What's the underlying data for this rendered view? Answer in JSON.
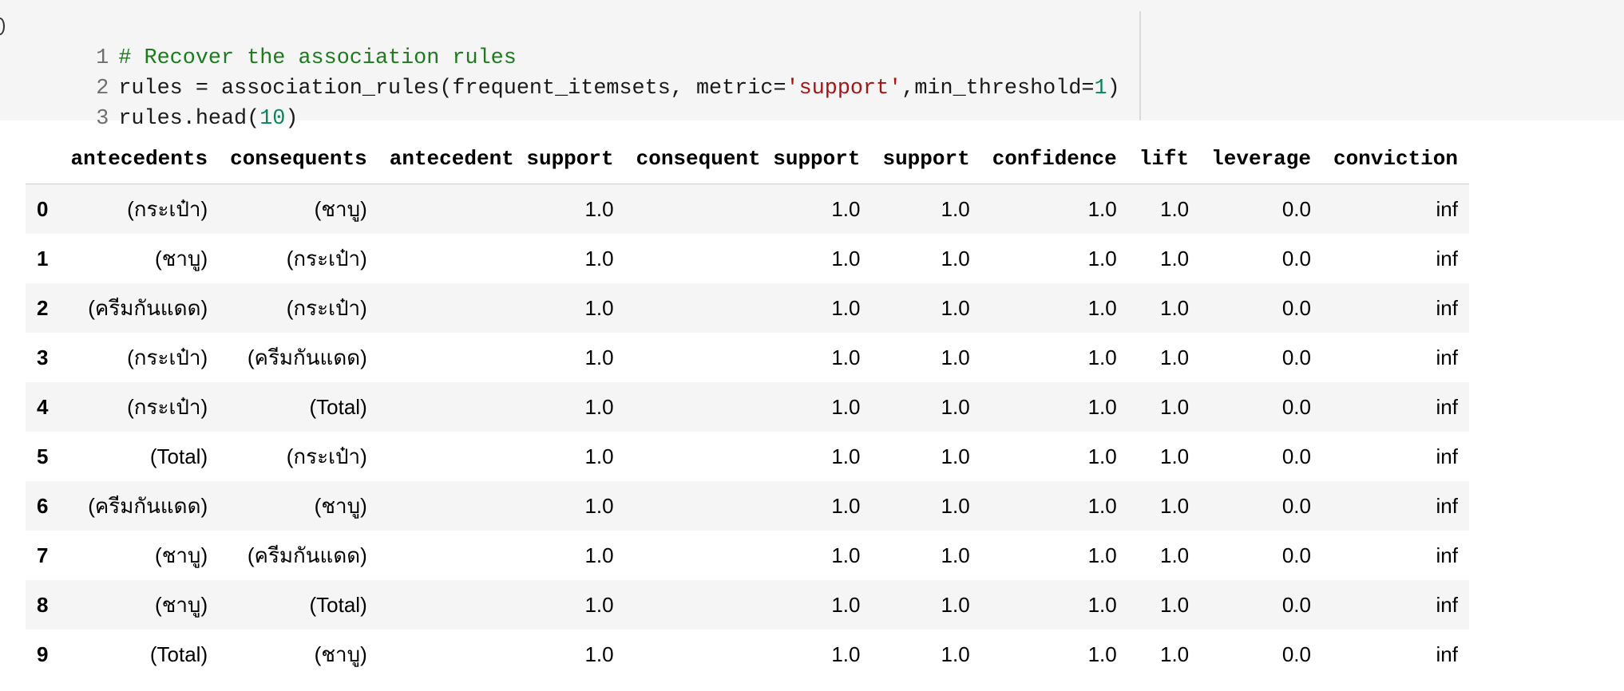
{
  "code": {
    "lines": [
      {
        "num": "1",
        "tokens": [
          {
            "t": "# Recover the association rules",
            "k": "comment"
          }
        ]
      },
      {
        "num": "2",
        "tokens": [
          {
            "t": "rules = association_rules(frequent_itemsets, metric=",
            "k": "plain"
          },
          {
            "t": "'support'",
            "k": "string"
          },
          {
            "t": ",min_threshold=",
            "k": "plain"
          },
          {
            "t": "1",
            "k": "number"
          },
          {
            "t": ")",
            "k": "plain"
          }
        ]
      },
      {
        "num": "3",
        "tokens": [
          {
            "t": "rules.head(",
            "k": "plain"
          },
          {
            "t": "10",
            "k": "number"
          },
          {
            "t": ")",
            "k": "plain"
          }
        ]
      }
    ]
  },
  "table": {
    "columns": [
      "antecedents",
      "consequents",
      "antecedent support",
      "consequent support",
      "support",
      "confidence",
      "lift",
      "leverage",
      "conviction"
    ],
    "rows": [
      {
        "index": "0",
        "cells": [
          "(กระเป๋า)",
          "(ชาบู)",
          "1.0",
          "1.0",
          "1.0",
          "1.0",
          "1.0",
          "0.0",
          "inf"
        ]
      },
      {
        "index": "1",
        "cells": [
          "(ชาบู)",
          "(กระเป๋า)",
          "1.0",
          "1.0",
          "1.0",
          "1.0",
          "1.0",
          "0.0",
          "inf"
        ]
      },
      {
        "index": "2",
        "cells": [
          "(ครีมกันแดด)",
          "(กระเป๋า)",
          "1.0",
          "1.0",
          "1.0",
          "1.0",
          "1.0",
          "0.0",
          "inf"
        ]
      },
      {
        "index": "3",
        "cells": [
          "(กระเป๋า)",
          "(ครีมกันแดด)",
          "1.0",
          "1.0",
          "1.0",
          "1.0",
          "1.0",
          "0.0",
          "inf"
        ]
      },
      {
        "index": "4",
        "cells": [
          "(กระเป๋า)",
          "(Total)",
          "1.0",
          "1.0",
          "1.0",
          "1.0",
          "1.0",
          "0.0",
          "inf"
        ]
      },
      {
        "index": "5",
        "cells": [
          "(Total)",
          "(กระเป๋า)",
          "1.0",
          "1.0",
          "1.0",
          "1.0",
          "1.0",
          "0.0",
          "inf"
        ]
      },
      {
        "index": "6",
        "cells": [
          "(ครีมกันแดด)",
          "(ชาบู)",
          "1.0",
          "1.0",
          "1.0",
          "1.0",
          "1.0",
          "0.0",
          "inf"
        ]
      },
      {
        "index": "7",
        "cells": [
          "(ชาบู)",
          "(ครีมกันแดด)",
          "1.0",
          "1.0",
          "1.0",
          "1.0",
          "1.0",
          "0.0",
          "inf"
        ]
      },
      {
        "index": "8",
        "cells": [
          "(ชาบู)",
          "(Total)",
          "1.0",
          "1.0",
          "1.0",
          "1.0",
          "1.0",
          "0.0",
          "inf"
        ]
      },
      {
        "index": "9",
        "cells": [
          "(Total)",
          "(ชาบู)",
          "1.0",
          "1.0",
          "1.0",
          "1.0",
          "1.0",
          "0.0",
          "inf"
        ]
      }
    ]
  },
  "colors": {
    "cell_background": "#f5f5f5",
    "comment": "#1e7a1e",
    "string": "#a31515",
    "number": "#098658",
    "line_number": "#6f6f6f"
  }
}
